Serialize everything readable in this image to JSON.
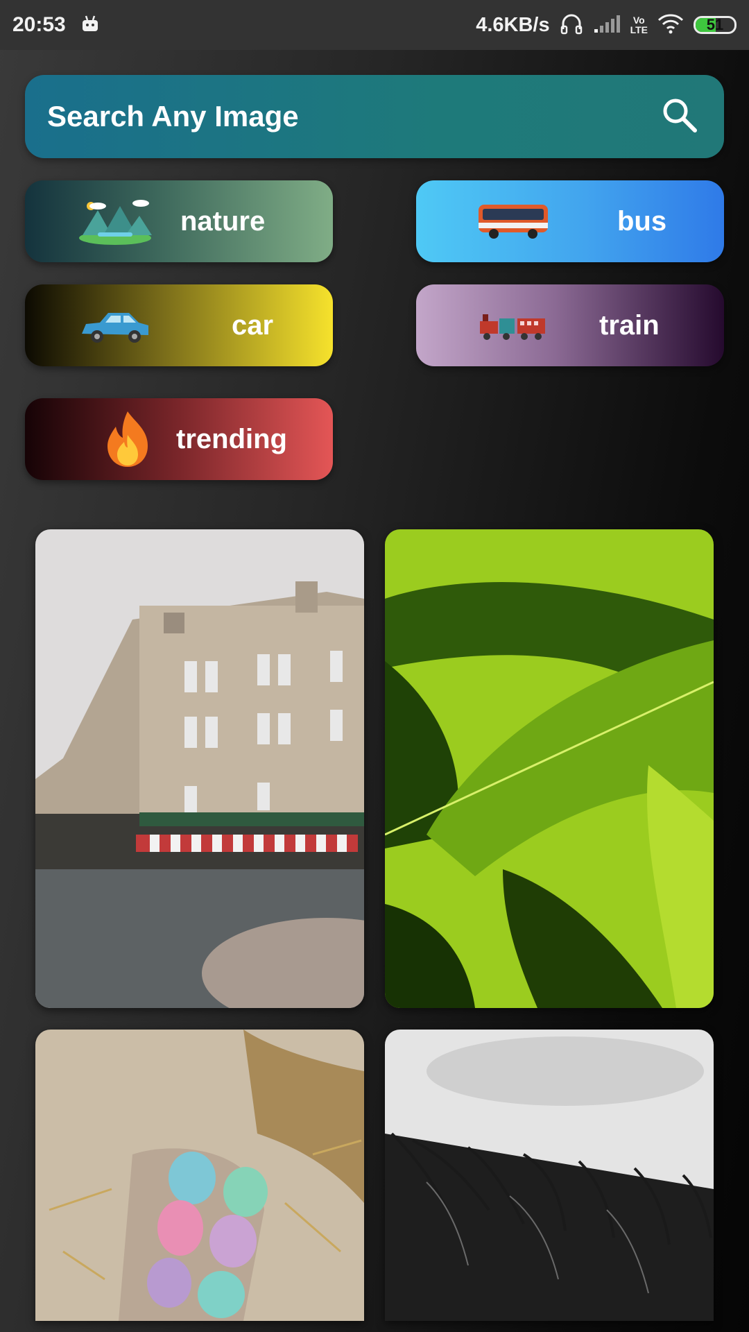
{
  "status_bar": {
    "time": "20:53",
    "net_speed": "4.6KB/s",
    "lte_top": "Vo",
    "lte_bottom": "LTE",
    "battery": "51",
    "battery_level": 0.51
  },
  "search": {
    "placeholder": "Search Any Image",
    "icon": "search-icon"
  },
  "categories": [
    {
      "label": "nature",
      "icon": "landscape-icon"
    },
    {
      "label": "bus",
      "icon": "bus-icon"
    },
    {
      "label": "car",
      "icon": "car-icon"
    },
    {
      "label": "train",
      "icon": "train-icon"
    },
    {
      "label": "trending",
      "icon": "fire-icon"
    }
  ],
  "gallery": [
    {
      "subject": "street-building-photo"
    },
    {
      "subject": "green-leaves-photo"
    },
    {
      "subject": "easter-eggs-photo"
    },
    {
      "subject": "grass-monochrome-photo"
    }
  ],
  "colors": {
    "search_bg": "#1e7a7a",
    "status_bar_bg": "#333333",
    "battery_fill": "#3ec63e"
  }
}
